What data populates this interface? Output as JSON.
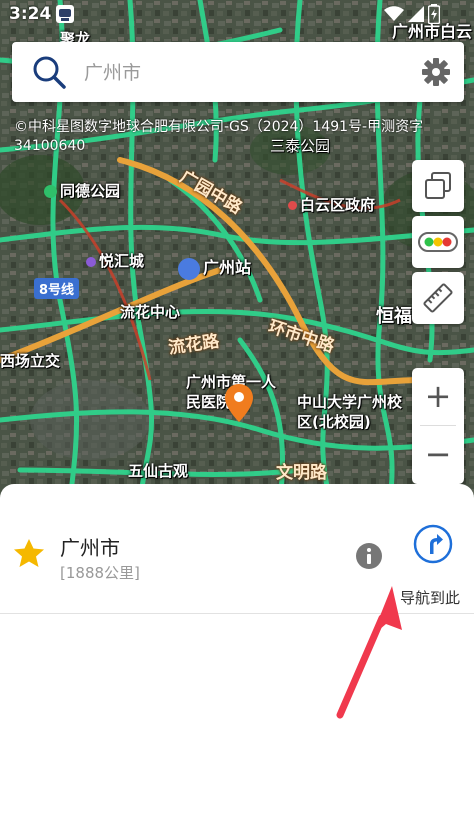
{
  "status_bar": {
    "time": "3:24",
    "icons": [
      "app-notification-icon",
      "wifi-icon",
      "signal-icon",
      "battery-icon"
    ]
  },
  "search": {
    "placeholder": "广州市"
  },
  "map": {
    "copyright": "©中科星图数字地球合肥有限公司-GS（2024）1491号-甲测资字34100640",
    "places": {
      "top_left": "聚龙",
      "top_right": "广州市白云",
      "sanxi": "三泰公园",
      "tongde": "同德公园",
      "baiyun_gov": "白云区政府",
      "yuehui": "悦汇城",
      "station": "广州站",
      "line8": "8号线",
      "liuhua_center": "流花中心",
      "hengfu": "恒福",
      "xichang": "西场立交",
      "hospital": "广州市第一人民医院",
      "sysu": "中山大学广州校区(北校园)",
      "wuxian": "五仙古观"
    },
    "roads": {
      "guangyuan": "广园中路",
      "liuhua": "流花路",
      "huanshi": "环市中路",
      "wenming": "文明路"
    }
  },
  "tools": {
    "zoom_in": "+",
    "zoom_out": "−"
  },
  "result": {
    "title": "广州市",
    "distance": "[1888公里]",
    "nav_label": "导航到此"
  },
  "colors": {
    "accent": "#1e6fd9",
    "star": "#f5b800",
    "marker": "#f07c1e",
    "annotation_arrow": "#f0394d",
    "road_green": "#2fd38c"
  }
}
